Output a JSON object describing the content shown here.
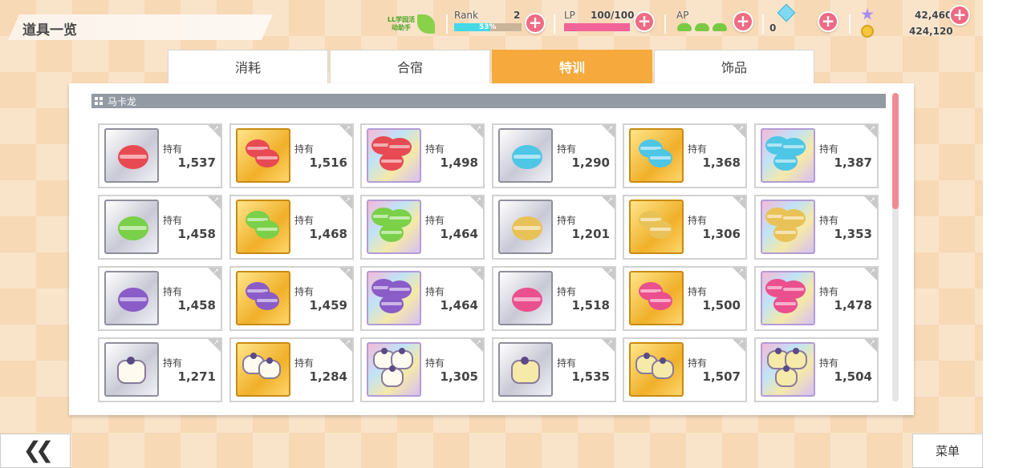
{
  "header": {
    "title": "道具一览",
    "badge_text": "LL学园活动助手",
    "rank": {
      "label": "Rank",
      "value": "2",
      "progress_text": "53%",
      "progress": 0.53
    },
    "lp": {
      "label": "LP",
      "value": "100/100",
      "progress": 1.0
    },
    "ap": {
      "label": "AP",
      "icon": "sneaker-icon"
    },
    "gems": {
      "value": "0",
      "icon": "diamond-icon"
    },
    "stars": {
      "value": "42,460",
      "icon": "star-icon"
    },
    "coins": {
      "value": "424,120",
      "icon": "coin-icon"
    },
    "plus_label": "+"
  },
  "tabs": [
    {
      "label": "消耗",
      "active": false
    },
    {
      "label": "合宿",
      "active": false
    },
    {
      "label": "特训",
      "active": true
    },
    {
      "label": "饰品",
      "active": false
    }
  ],
  "section": {
    "title": "马卡龙"
  },
  "items_label": "持有",
  "colors": {
    "red": "#e84a53",
    "blue": "#4ec6e6",
    "green": "#7ad048",
    "yellow": "#e9c257",
    "purple": "#8a5cc8",
    "pink": "#ea4f8e",
    "accent": "#f6a93c"
  },
  "items": [
    {
      "count": "1,537",
      "frame": "silver",
      "color": "red",
      "kind": "single"
    },
    {
      "count": "1,516",
      "frame": "gold",
      "color": "red",
      "kind": "double"
    },
    {
      "count": "1,498",
      "frame": "rainbow",
      "color": "red",
      "kind": "triple"
    },
    {
      "count": "1,290",
      "frame": "silver",
      "color": "blue",
      "kind": "single"
    },
    {
      "count": "1,368",
      "frame": "gold",
      "color": "blue",
      "kind": "double"
    },
    {
      "count": "1,387",
      "frame": "rainbow",
      "color": "blue",
      "kind": "triple"
    },
    {
      "count": "1,458",
      "frame": "silver",
      "color": "green",
      "kind": "single"
    },
    {
      "count": "1,468",
      "frame": "gold",
      "color": "green",
      "kind": "double"
    },
    {
      "count": "1,464",
      "frame": "rainbow",
      "color": "green",
      "kind": "triple"
    },
    {
      "count": "1,201",
      "frame": "silver",
      "color": "yellow",
      "kind": "single"
    },
    {
      "count": "1,306",
      "frame": "gold",
      "color": "yellow",
      "kind": "double"
    },
    {
      "count": "1,353",
      "frame": "rainbow",
      "color": "yellow",
      "kind": "triple"
    },
    {
      "count": "1,458",
      "frame": "silver",
      "color": "purple",
      "kind": "single"
    },
    {
      "count": "1,459",
      "frame": "gold",
      "color": "purple",
      "kind": "double"
    },
    {
      "count": "1,464",
      "frame": "rainbow",
      "color": "purple",
      "kind": "triple"
    },
    {
      "count": "1,518",
      "frame": "silver",
      "color": "pink",
      "kind": "single"
    },
    {
      "count": "1,500",
      "frame": "gold",
      "color": "pink",
      "kind": "double"
    },
    {
      "count": "1,478",
      "frame": "rainbow",
      "color": "pink",
      "kind": "triple"
    },
    {
      "count": "1,271",
      "frame": "silver",
      "color": "white-cake",
      "kind": "cake1"
    },
    {
      "count": "1,284",
      "frame": "gold",
      "color": "white-cake",
      "kind": "cake2"
    },
    {
      "count": "1,305",
      "frame": "rainbow",
      "color": "white-cake",
      "kind": "cake3"
    },
    {
      "count": "1,535",
      "frame": "silver",
      "color": "yellow-cake",
      "kind": "cake1"
    },
    {
      "count": "1,507",
      "frame": "gold",
      "color": "yellow-cake",
      "kind": "cake2"
    },
    {
      "count": "1,504",
      "frame": "rainbow",
      "color": "yellow-cake",
      "kind": "cake3"
    }
  ],
  "footer": {
    "back_label": "❮❮",
    "menu_label": "菜单"
  }
}
